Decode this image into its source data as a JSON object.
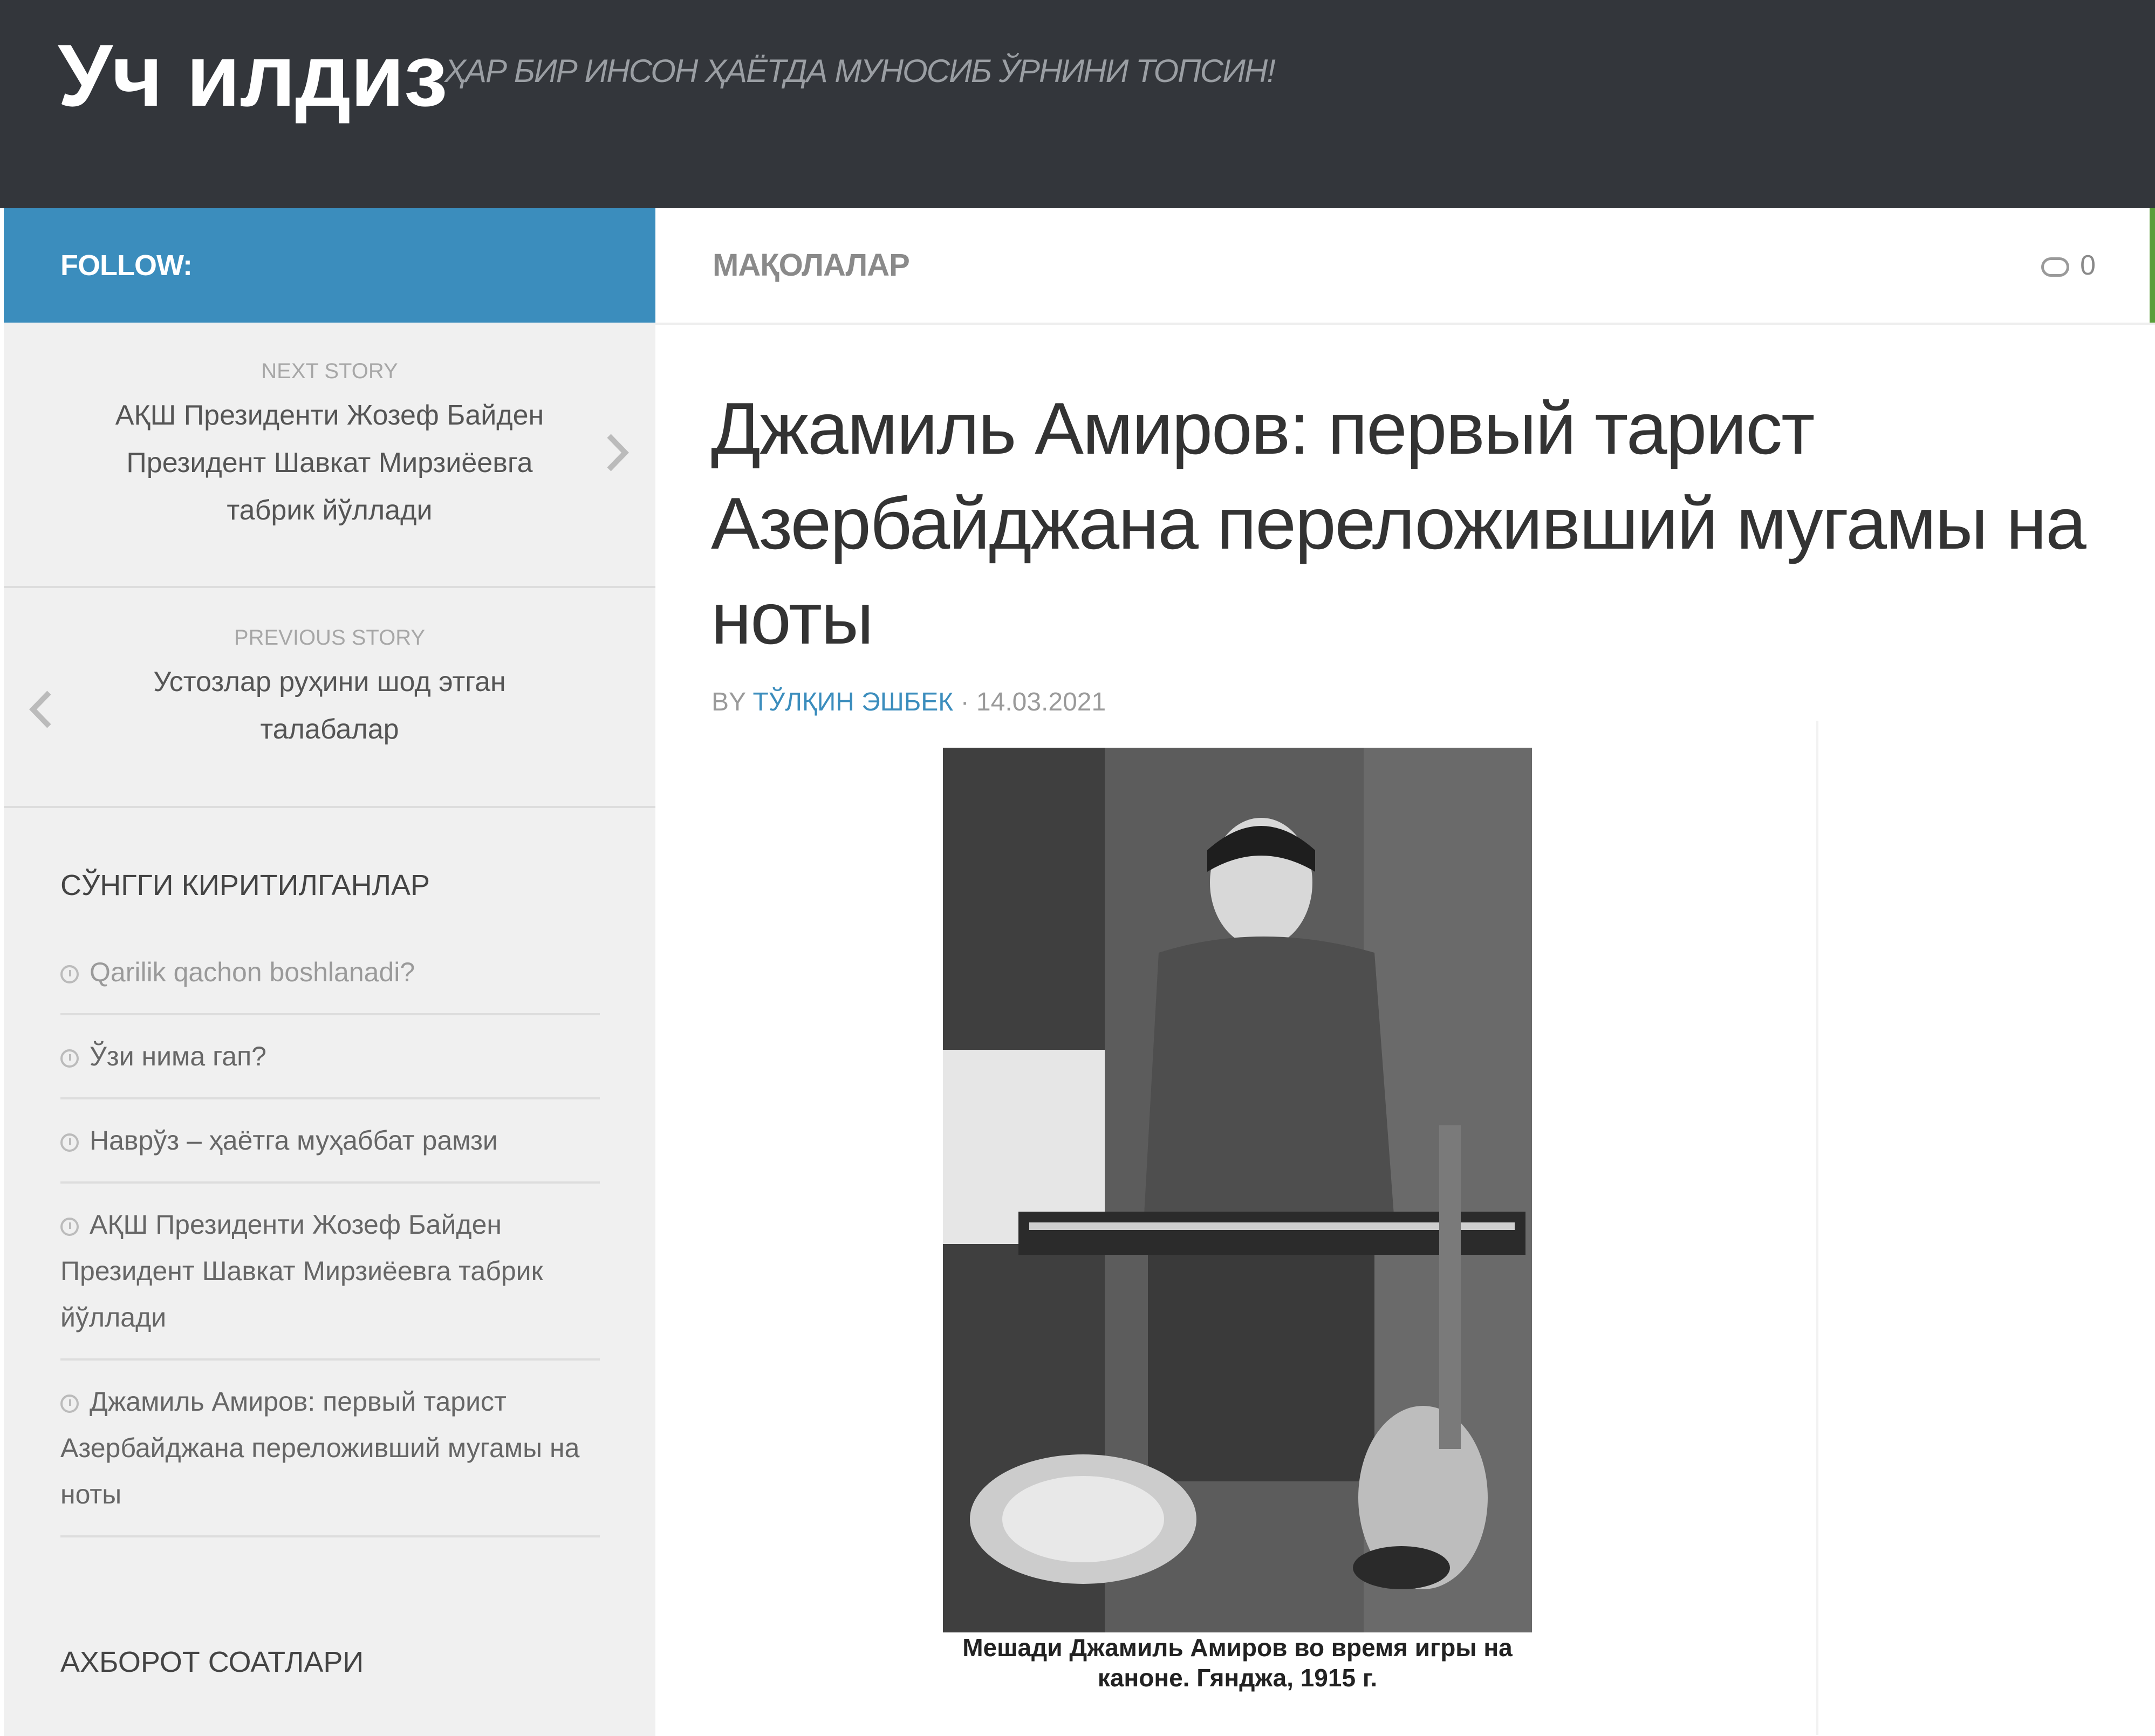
{
  "site": {
    "title": "Уч илдиз",
    "tagline": "ҲАР БИР ИНСОН ҲАЁТДА МУНОСИБ ЎРНИНИ ТОПСИН!"
  },
  "sidebar": {
    "follow_label": "FOLLOW:",
    "next_story": {
      "kicker": "NEXT STORY",
      "title": "АҚШ Президенти Жозеф Байден Президент Шавкат Мирзиёевга табрик йўллади"
    },
    "previous_story": {
      "kicker": "PREVIOUS STORY",
      "title": "Устозлар руҳини шод этган талабалар"
    },
    "recent_heading": "СЎНГГИ КИРИТИЛГАНЛАР",
    "recent_items": [
      "Qarilik qachon boshlanadi?",
      "Ўзи нима гап?",
      "Наврўз – ҳаётга муҳаббат рамзи",
      "АҚШ Президенти Жозеф Байден Президент Шавкат Мирзиёевга табрик йўллади",
      "Джамиль Амиров: первый тарист Азербайджана переложивший мугамы на ноты"
    ],
    "news_heading": "АХБОРОТ СОАТЛАРИ"
  },
  "main": {
    "category": "МАҚОЛАЛАР",
    "comments_count": "0",
    "post_title": "Джамиль Амиров: первый тарист Азербайджана переложивший мугамы на ноты",
    "byline": {
      "by": "BY",
      "author": "ТЎЛҚИН ЭШБЕК",
      "separator": " · ",
      "date": "14.03.2021"
    },
    "image_caption": "Мешади Джамиль Амиров во время игры на каноне. Гянджа, 1915 г."
  },
  "icons": {
    "next": "chevron-right-icon",
    "previous": "chevron-left-icon",
    "recent": "clock-icon",
    "comments": "comment-bubble-icon"
  },
  "colors": {
    "header_bg": "#33363b",
    "follow_bg": "#3b8dbd",
    "sidebar_bg": "#f0f0f0",
    "accent": "#3b8dbd"
  }
}
